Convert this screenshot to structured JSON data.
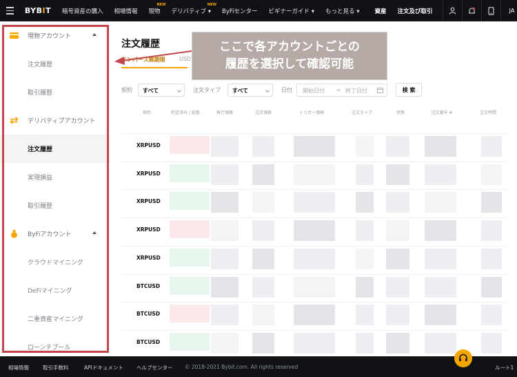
{
  "topnav": {
    "logo": "BYB",
    "logo_dot": "I",
    "logo_end": "T",
    "items": [
      {
        "label": "暗号資産の購入",
        "badge": ""
      },
      {
        "label": "相場情報",
        "badge": ""
      },
      {
        "label": "現物",
        "badge": "NEW"
      },
      {
        "label": "デリバティブ ▾",
        "badge": "NEW"
      },
      {
        "label": "ByFiセンター",
        "badge": ""
      },
      {
        "label": "ビギナーガイド ▾",
        "badge": ""
      },
      {
        "label": "もっと見る ▾",
        "badge": ""
      },
      {
        "label": "資産",
        "badge": ""
      },
      {
        "label": "注文及び取引",
        "badge": ""
      }
    ],
    "lang": "JA"
  },
  "sidebar": {
    "groups": [
      {
        "label": "現物アカウント",
        "items": [
          "注文履歴",
          "取引履歴"
        ]
      },
      {
        "label": "デリバティブアカウント",
        "items": [
          "注文履歴",
          "実現損益",
          "取引履歴"
        ]
      },
      {
        "label": "ByFiアカウント",
        "items": [
          "クラウドマイニング",
          "DeFiマイニング",
          "二重資産マイニング",
          "ローンチプール"
        ]
      }
    ]
  },
  "main": {
    "title": "注文履歴",
    "tab_active": "インバース無期限",
    "tab_other": "USDT",
    "annotation_line1": "ここで各アカウントごとの",
    "annotation_line2": "履歴を選択して確認可能"
  },
  "filters": {
    "contract_label": "契約",
    "contract_value": "すべて",
    "order_type_label": "注文タイプ",
    "order_type_value": "すべて",
    "date_label": "日付",
    "start_placeholder": "開始日付",
    "arrow": "→",
    "end_placeholder": "終了日付",
    "search_button": "検 索"
  },
  "table": {
    "headers": [
      "契約",
      "約定済み / 総数",
      "執行価格",
      "注文価格",
      "トリガー価格",
      "注文タイプ",
      "状態",
      "注文番号 #",
      "注文時間"
    ],
    "rows": [
      "XRPUSD",
      "XRPUSD",
      "XRPUSD",
      "XRPUSD",
      "XRPUSD",
      "BTCUSD",
      "BTCUSD",
      "BTCUSD"
    ]
  },
  "footer": {
    "items": [
      "相場情報",
      "取引手数料",
      "APIドキュメント",
      "ヘルプセンター"
    ],
    "copyright": "© 2018-2021 Bybit.com. All rights reserved",
    "right": "ルート1"
  },
  "colors": {
    "accent": "#f7a600",
    "frame": "#c1454b",
    "annotation_bg": "#b5aaa6"
  }
}
